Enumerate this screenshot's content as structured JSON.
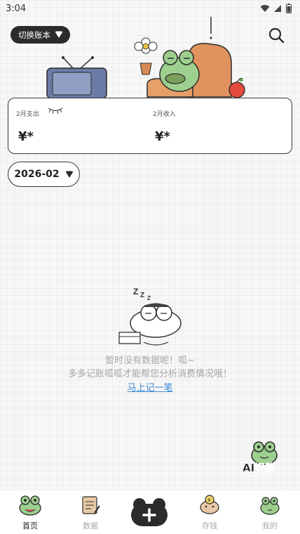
{
  "status": {
    "time": "3:04"
  },
  "header": {
    "switch_account_label": "切换账本"
  },
  "stats": {
    "expense_label": "2月支出",
    "expense_value": "¥*",
    "income_label": "2月收入",
    "income_value": "¥*"
  },
  "month": {
    "label": "2026-02"
  },
  "empty_state": {
    "line1": "暂时没有数据呢！呱~",
    "line2": "多多记账呱呱才能帮您分析消费情况哦！",
    "link": "马上记一笔"
  },
  "ai_button": {
    "label": "AI记账"
  },
  "tabs": [
    {
      "label": "首页",
      "icon": "frog-home-icon"
    },
    {
      "label": "数据",
      "icon": "notebook-icon"
    },
    {
      "label": "存钱",
      "icon": "piggy-bank-icon"
    },
    {
      "label": "我的",
      "icon": "frog-profile-icon"
    }
  ],
  "colors": {
    "accent": "#2b2b2b",
    "link": "#3b8bd9",
    "frog_green": "#8bc48a"
  }
}
